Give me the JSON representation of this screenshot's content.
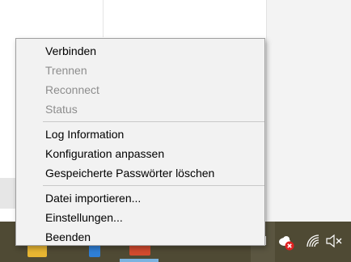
{
  "menu": {
    "items": [
      {
        "label": "Verbinden",
        "enabled": true
      },
      {
        "label": "Trennen",
        "enabled": false
      },
      {
        "label": "Reconnect",
        "enabled": false
      },
      {
        "label": "Status",
        "enabled": false
      },
      {
        "label": "Log Information",
        "enabled": true
      },
      {
        "label": "Konfiguration anpassen",
        "enabled": true
      },
      {
        "label": "Gespeicherte Passwörter löschen",
        "enabled": true
      },
      {
        "label": "Datei importieren...",
        "enabled": true
      },
      {
        "label": "Einstellungen...",
        "enabled": true
      },
      {
        "label": "Beenden",
        "enabled": true
      }
    ]
  },
  "taskbar": {
    "apps": [
      {
        "icon": "file-explorer-icon",
        "color": "#e8b632"
      },
      {
        "icon": "app-blue-icon",
        "color": "#2f7fd6"
      },
      {
        "icon": "app-red-icon",
        "color": "#d24a2e"
      }
    ],
    "tray": {
      "icons": [
        "tray-window-icon",
        "vpn-disconnected-icon",
        "wifi-icon",
        "speaker-muted-icon"
      ]
    }
  },
  "colors": {
    "taskbar": "#4f4a34",
    "menu_background": "#f2f2f2",
    "disabled_text": "#8d8d8d"
  }
}
